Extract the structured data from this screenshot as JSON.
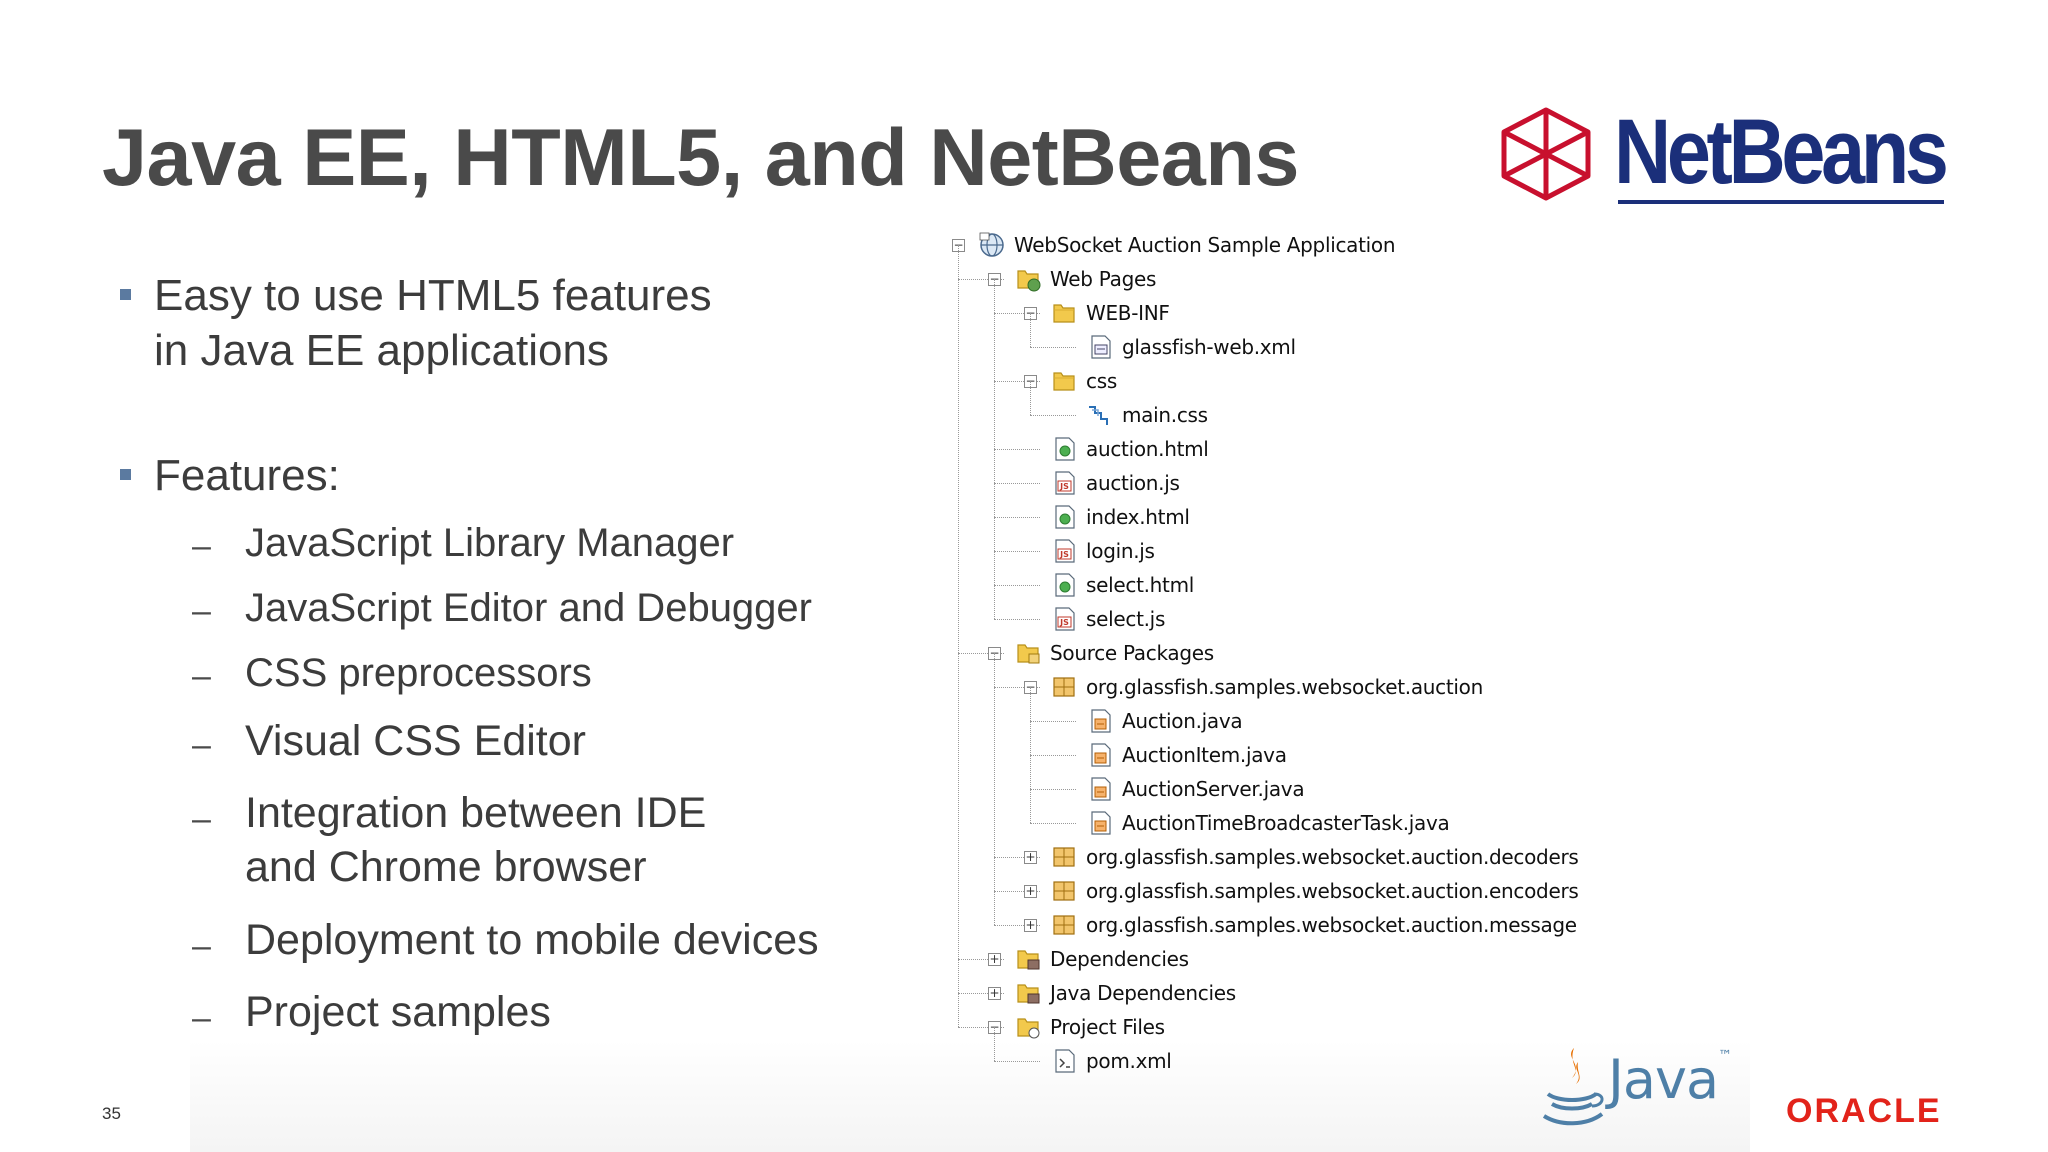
{
  "slide": {
    "title": "Java EE, HTML5, and NetBeans",
    "page_number": "35"
  },
  "bullets": [
    {
      "lines": [
        "Easy to use HTML5 features",
        "in Java EE applications"
      ]
    },
    {
      "lines": [
        "Features:"
      ]
    }
  ],
  "sub_dash": "–",
  "features": [
    {
      "lines": [
        "JavaScript Library Manager"
      ]
    },
    {
      "lines": [
        "JavaScript Editor and Debugger"
      ]
    },
    {
      "lines": [
        "CSS preprocessors"
      ]
    },
    {
      "lines": [
        "Visual CSS Editor"
      ]
    },
    {
      "lines": [
        "Integration between IDE",
        "and Chrome browser"
      ]
    },
    {
      "lines": [
        "Deployment to mobile devices"
      ]
    },
    {
      "lines": [
        "Project samples"
      ]
    }
  ],
  "tree": [
    {
      "label": "WebSocket Auction Sample Application",
      "depth": 0,
      "icon": "project-icon",
      "expander": "minus"
    },
    {
      "label": "Web Pages",
      "depth": 1,
      "icon": "web-pages-folder-icon",
      "expander": "minus"
    },
    {
      "label": "WEB-INF",
      "depth": 2,
      "icon": "folder-icon",
      "expander": "minus"
    },
    {
      "label": "glassfish-web.xml",
      "depth": 3,
      "icon": "xml-config-file-icon",
      "expander": ""
    },
    {
      "label": "css",
      "depth": 2,
      "icon": "folder-icon",
      "expander": "minus"
    },
    {
      "label": "main.css",
      "depth": 3,
      "icon": "css-file-icon",
      "expander": ""
    },
    {
      "label": "auction.html",
      "depth": 2,
      "icon": "html-file-icon",
      "expander": ""
    },
    {
      "label": "auction.js",
      "depth": 2,
      "icon": "js-file-icon",
      "expander": ""
    },
    {
      "label": "index.html",
      "depth": 2,
      "icon": "html-file-icon",
      "expander": ""
    },
    {
      "label": "login.js",
      "depth": 2,
      "icon": "js-file-icon",
      "expander": ""
    },
    {
      "label": "select.html",
      "depth": 2,
      "icon": "html-file-icon",
      "expander": ""
    },
    {
      "label": "select.js",
      "depth": 2,
      "icon": "js-file-icon",
      "expander": ""
    },
    {
      "label": "Source Packages",
      "depth": 1,
      "icon": "source-packages-folder-icon",
      "expander": "minus"
    },
    {
      "label": "org.glassfish.samples.websocket.auction",
      "depth": 2,
      "icon": "package-icon",
      "expander": "minus"
    },
    {
      "label": "Auction.java",
      "depth": 3,
      "icon": "java-file-icon",
      "expander": ""
    },
    {
      "label": "AuctionItem.java",
      "depth": 3,
      "icon": "java-file-icon",
      "expander": ""
    },
    {
      "label": "AuctionServer.java",
      "depth": 3,
      "icon": "java-file-icon",
      "expander": ""
    },
    {
      "label": "AuctionTimeBroadcasterTask.java",
      "depth": 3,
      "icon": "java-file-icon",
      "expander": ""
    },
    {
      "label": "org.glassfish.samples.websocket.auction.decoders",
      "depth": 2,
      "icon": "package-icon",
      "expander": "plus"
    },
    {
      "label": "org.glassfish.samples.websocket.auction.encoders",
      "depth": 2,
      "icon": "package-icon",
      "expander": "plus"
    },
    {
      "label": "org.glassfish.samples.websocket.auction.message",
      "depth": 2,
      "icon": "package-icon",
      "expander": "plus"
    },
    {
      "label": "Dependencies",
      "depth": 1,
      "icon": "dependencies-folder-icon",
      "expander": "plus"
    },
    {
      "label": "Java Dependencies",
      "depth": 1,
      "icon": "dependencies-folder-icon",
      "expander": "plus"
    },
    {
      "label": "Project Files",
      "depth": 1,
      "icon": "project-files-folder-icon",
      "expander": "minus"
    },
    {
      "label": "pom.xml",
      "depth": 2,
      "icon": "pom-file-icon",
      "expander": ""
    }
  ],
  "logos": {
    "netbeans": "NetBeans",
    "java": "Java",
    "java_tm": "™",
    "oracle": "ORACLE"
  },
  "colors": {
    "title": "#4a4a4a",
    "bullet_square": "#5b7aa0",
    "netbeans_blue": "#1b2f7a",
    "netbeans_red": "#c8102e",
    "java_blue": "#4e7fa7",
    "java_orange": "#e76f00",
    "oracle_red": "#e2231a"
  }
}
